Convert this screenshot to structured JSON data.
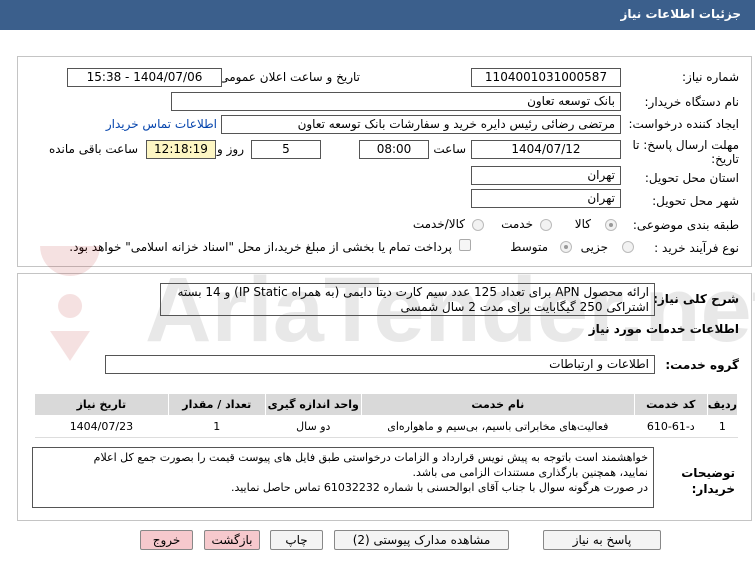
{
  "header": {
    "title": "جزئیات اطلاعات نیاز"
  },
  "fields": {
    "need_number_label": "شماره نیاز:",
    "need_number": "1104001031000587",
    "announce_label": "تاریخ و ساعت اعلان عمومی:",
    "announce_value": "1404/07/06 - 15:38",
    "buyer_org_label": "نام دستگاه خریدار:",
    "buyer_org": "بانک توسعه تعاون",
    "creator_label": "ایجاد کننده درخواست:",
    "creator": "مرتضی رضائی رئیس دایره خرید و سفارشات بانک توسعه تعاون",
    "contact_link": "اطلاعات تماس خریدار",
    "deadline_label_1": "مهلت ارسال پاسخ: تا",
    "deadline_label_2": "تاریخ:",
    "deadline_date": "1404/07/12",
    "hour_label": "ساعت",
    "deadline_time": "08:00",
    "days": "5",
    "days_label": "روز و",
    "remaining_time": "12:18:19",
    "remaining_label": "ساعت باقی مانده",
    "province_label": "استان محل تحویل:",
    "province": "تهران",
    "city_label": "شهر محل تحویل:",
    "city": "تهران",
    "category_label": "طبقه بندی موضوعی:",
    "category_options": [
      "کالا",
      "خدمت",
      "کالا/خدمت"
    ],
    "process_label": "نوع فرآیند خرید :",
    "process_options": [
      "جزیی",
      "متوسط"
    ],
    "payment_note": "پرداخت تمام یا بخشی از مبلغ خرید،از محل \"اسناد خزانه اسلامی\" خواهد بود."
  },
  "summary": {
    "label": "شرح کلی نیاز:",
    "text": "ارائه محصول APN برای تعداد 125 عدد سیم کارت دیتا دایمی (به همراه IP Static) و 14 بسته اشتراکی 250 گیگابایت برای مدت 2 سال شمسی"
  },
  "services": {
    "section_title": "اطلاعات خدمات مورد نیاز",
    "group_label": "گروه خدمت:",
    "group_value": "اطلاعات و ارتباطات",
    "columns": [
      "ردیف",
      "کد خدمت",
      "نام خدمت",
      "واحد اندازه گیری",
      "تعداد / مقدار",
      "تاریخ نیاز"
    ],
    "rows": [
      {
        "row": "1",
        "code": "د-61-610",
        "name": "فعالیت‌های مخابراتی باسیم، بی‌سیم و ماهواره‌ای",
        "unit": "دو سال",
        "qty": "1",
        "date": "1404/07/23"
      }
    ]
  },
  "notes": {
    "label_1": "توضیحات",
    "label_2": "خریدار:",
    "line1": "خواهشمند است باتوجه به پیش نویس قرارداد و الزامات درخواستی طبق فایل های پیوست قیمت را بصورت جمع کل اعلام",
    "line2": "نمایید، همچنین بارگذاری مستندات الزامی می باشد.",
    "line3": "در صورت هرگونه سوال با جناب آقای ابوالحسنی با شماره 61032232 تماس حاصل نمایید."
  },
  "buttons": {
    "reply": "پاسخ به نیاز",
    "attachments": "مشاهده مدارک پیوستی (2)",
    "print": "چاپ",
    "back": "بازگشت",
    "exit": "خروج"
  },
  "watermark": {
    "text": "AriaTender.net"
  },
  "colors": {
    "header": "#3b5f8c",
    "highlight": "#fdf6c3",
    "button_pink": "#f6c9cd",
    "link": "#0645ad"
  }
}
